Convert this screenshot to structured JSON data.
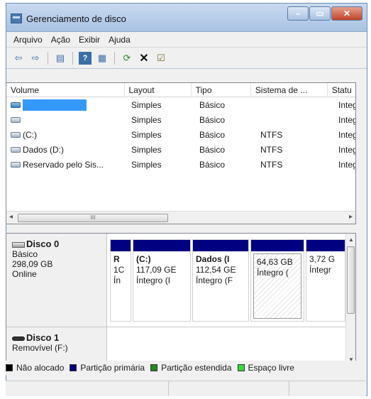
{
  "window": {
    "title": "Gerenciamento de disco",
    "minimize": "–",
    "maximize": "▭",
    "close": "✕"
  },
  "menu": [
    "Arquivo",
    "Ação",
    "Exibir",
    "Ajuda"
  ],
  "volumes": {
    "headers": [
      "Volume",
      "Layout",
      "Tipo",
      "Sistema de ...",
      "Statu"
    ],
    "rows": [
      {
        "name": "",
        "layout": "Simples",
        "tipo": "Básico",
        "fs": "",
        "status": "Integ"
      },
      {
        "name": "",
        "layout": "Simples",
        "tipo": "Básico",
        "fs": "",
        "status": "Integ"
      },
      {
        "name": "(C:)",
        "layout": "Simples",
        "tipo": "Básico",
        "fs": "NTFS",
        "status": "Integ"
      },
      {
        "name": "Dados (D:)",
        "layout": "Simples",
        "tipo": "Básico",
        "fs": "NTFS",
        "status": "Integ"
      },
      {
        "name": "Reservado pelo Sis...",
        "layout": "Simples",
        "tipo": "Básico",
        "fs": "NTFS",
        "status": "Integ"
      }
    ],
    "hscroll_grip": "III"
  },
  "disks": [
    {
      "name": "Disco 0",
      "type": "Básico",
      "size": "298,09 GB",
      "state": "Online",
      "partitions": [
        {
          "lines": [
            "R",
            "1C",
            "Ín"
          ]
        },
        {
          "lines": [
            "(C:)",
            "117,09 GE",
            "Íntegro (I"
          ]
        },
        {
          "lines": [
            "Dados (I",
            "112,54 GE",
            "Íntegro (F"
          ]
        },
        {
          "lines": [
            "",
            "64,63 GB",
            "Íntegro ("
          ]
        },
        {
          "lines": [
            "",
            "3,72 G",
            "Íntegr"
          ]
        }
      ]
    },
    {
      "name": "Disco 1",
      "type": "Removível (F:)"
    }
  ],
  "legend": [
    {
      "label": "Não alocado",
      "color": "#000000"
    },
    {
      "label": "Partição primária",
      "color": "#000080"
    },
    {
      "label": "Partição estendida",
      "color": "#1f8a1f"
    },
    {
      "label": "Espaço livre",
      "color": "#33dd33"
    }
  ]
}
